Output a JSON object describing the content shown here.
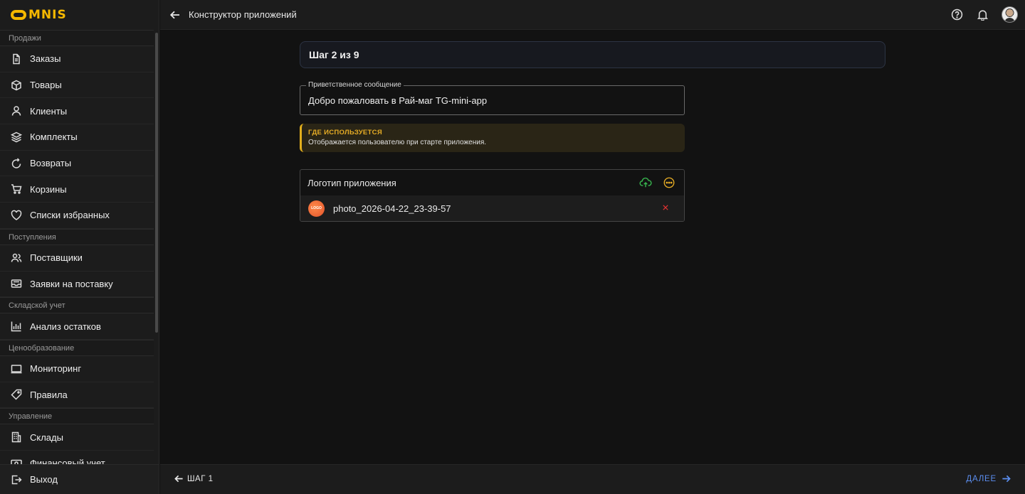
{
  "app": {
    "logo_text": "MNIS"
  },
  "header": {
    "title": "Конструктор приложений"
  },
  "sidebar": {
    "sections": [
      {
        "label": "Продажи"
      },
      {
        "label": "Поступления"
      },
      {
        "label": "Складской учет"
      },
      {
        "label": "Ценообразование"
      },
      {
        "label": "Управление"
      }
    ],
    "items": [
      {
        "label": "Заказы",
        "icon": "file-icon"
      },
      {
        "label": "Товары",
        "icon": "box-icon"
      },
      {
        "label": "Клиенты",
        "icon": "user-icon"
      },
      {
        "label": "Комплекты",
        "icon": "layers-icon"
      },
      {
        "label": "Возвраты",
        "icon": "refresh-icon"
      },
      {
        "label": "Корзины",
        "icon": "cart-icon"
      },
      {
        "label": "Списки избранных",
        "icon": "heart-icon"
      },
      {
        "label": "Поставщики",
        "icon": "users-icon"
      },
      {
        "label": "Заявки на поставку",
        "icon": "inbox-icon"
      },
      {
        "label": "Анализ остатков",
        "icon": "bar-chart-icon"
      },
      {
        "label": "Мониторинг",
        "icon": "monitor-icon"
      },
      {
        "label": "Правила",
        "icon": "tag-icon"
      },
      {
        "label": "Склады",
        "icon": "building-icon"
      },
      {
        "label": "Финансовый учет",
        "icon": "money-icon"
      }
    ],
    "logout_label": "Выход"
  },
  "main": {
    "step_label": "Шаг 2 из 9",
    "welcome": {
      "label": "Приветственное сообщение",
      "value": "Добро пожаловать в Рай-маг TG-mini-app"
    },
    "note": {
      "title": "ГДЕ ИСПОЛЬЗУЕТСЯ",
      "text": "Отображается пользователю при старте приложения."
    },
    "logo_section": {
      "title": "Логотип приложения",
      "file_name": "photo_2026-04-22_23-39-57",
      "thumb_text": "LOGO"
    }
  },
  "footer": {
    "prev_label": "ШАГ 1",
    "next_label": "ДАЛЕЕ"
  },
  "colors": {
    "accent_blue": "#5b8ef0",
    "warning": "#e6ac25",
    "upload_green": "#37b24d",
    "remove_red": "#e03131"
  }
}
